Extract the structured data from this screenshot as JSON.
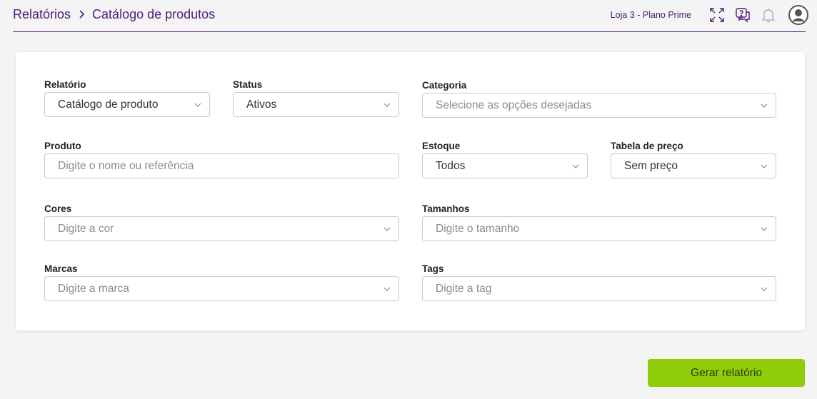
{
  "header": {
    "breadcrumb": [
      "Relatórios",
      "Catálogo de produtos"
    ],
    "store_label": "Loja 3 - Plano Prime",
    "icons": [
      "expand-icon",
      "help-chat-icon",
      "bell-icon",
      "user-avatar-icon"
    ]
  },
  "form": {
    "relatorio": {
      "label": "Relatório",
      "value": "Catálogo de produto"
    },
    "status": {
      "label": "Status",
      "value": "Ativos"
    },
    "categoria": {
      "label": "Categoria",
      "placeholder": "Selecione as opções desejadas"
    },
    "produto": {
      "label": "Produto",
      "placeholder": "Digite o nome ou referência"
    },
    "estoque": {
      "label": "Estoque",
      "value": "Todos"
    },
    "tabela_preco": {
      "label": "Tabela de preço",
      "value": "Sem preço"
    },
    "cores": {
      "label": "Cores",
      "placeholder": "Digite a cor"
    },
    "tamanhos": {
      "label": "Tamanhos",
      "placeholder": "Digite o tamanho"
    },
    "marcas": {
      "label": "Marcas",
      "placeholder": "Digite a marca"
    },
    "tags": {
      "label": "Tags",
      "placeholder": "Digite a tag"
    }
  },
  "actions": {
    "generate_label": "Gerar relatório"
  },
  "colors": {
    "brand": "#4a1f78",
    "accent": "#8fcc0a",
    "background": "#f4f4f4"
  }
}
